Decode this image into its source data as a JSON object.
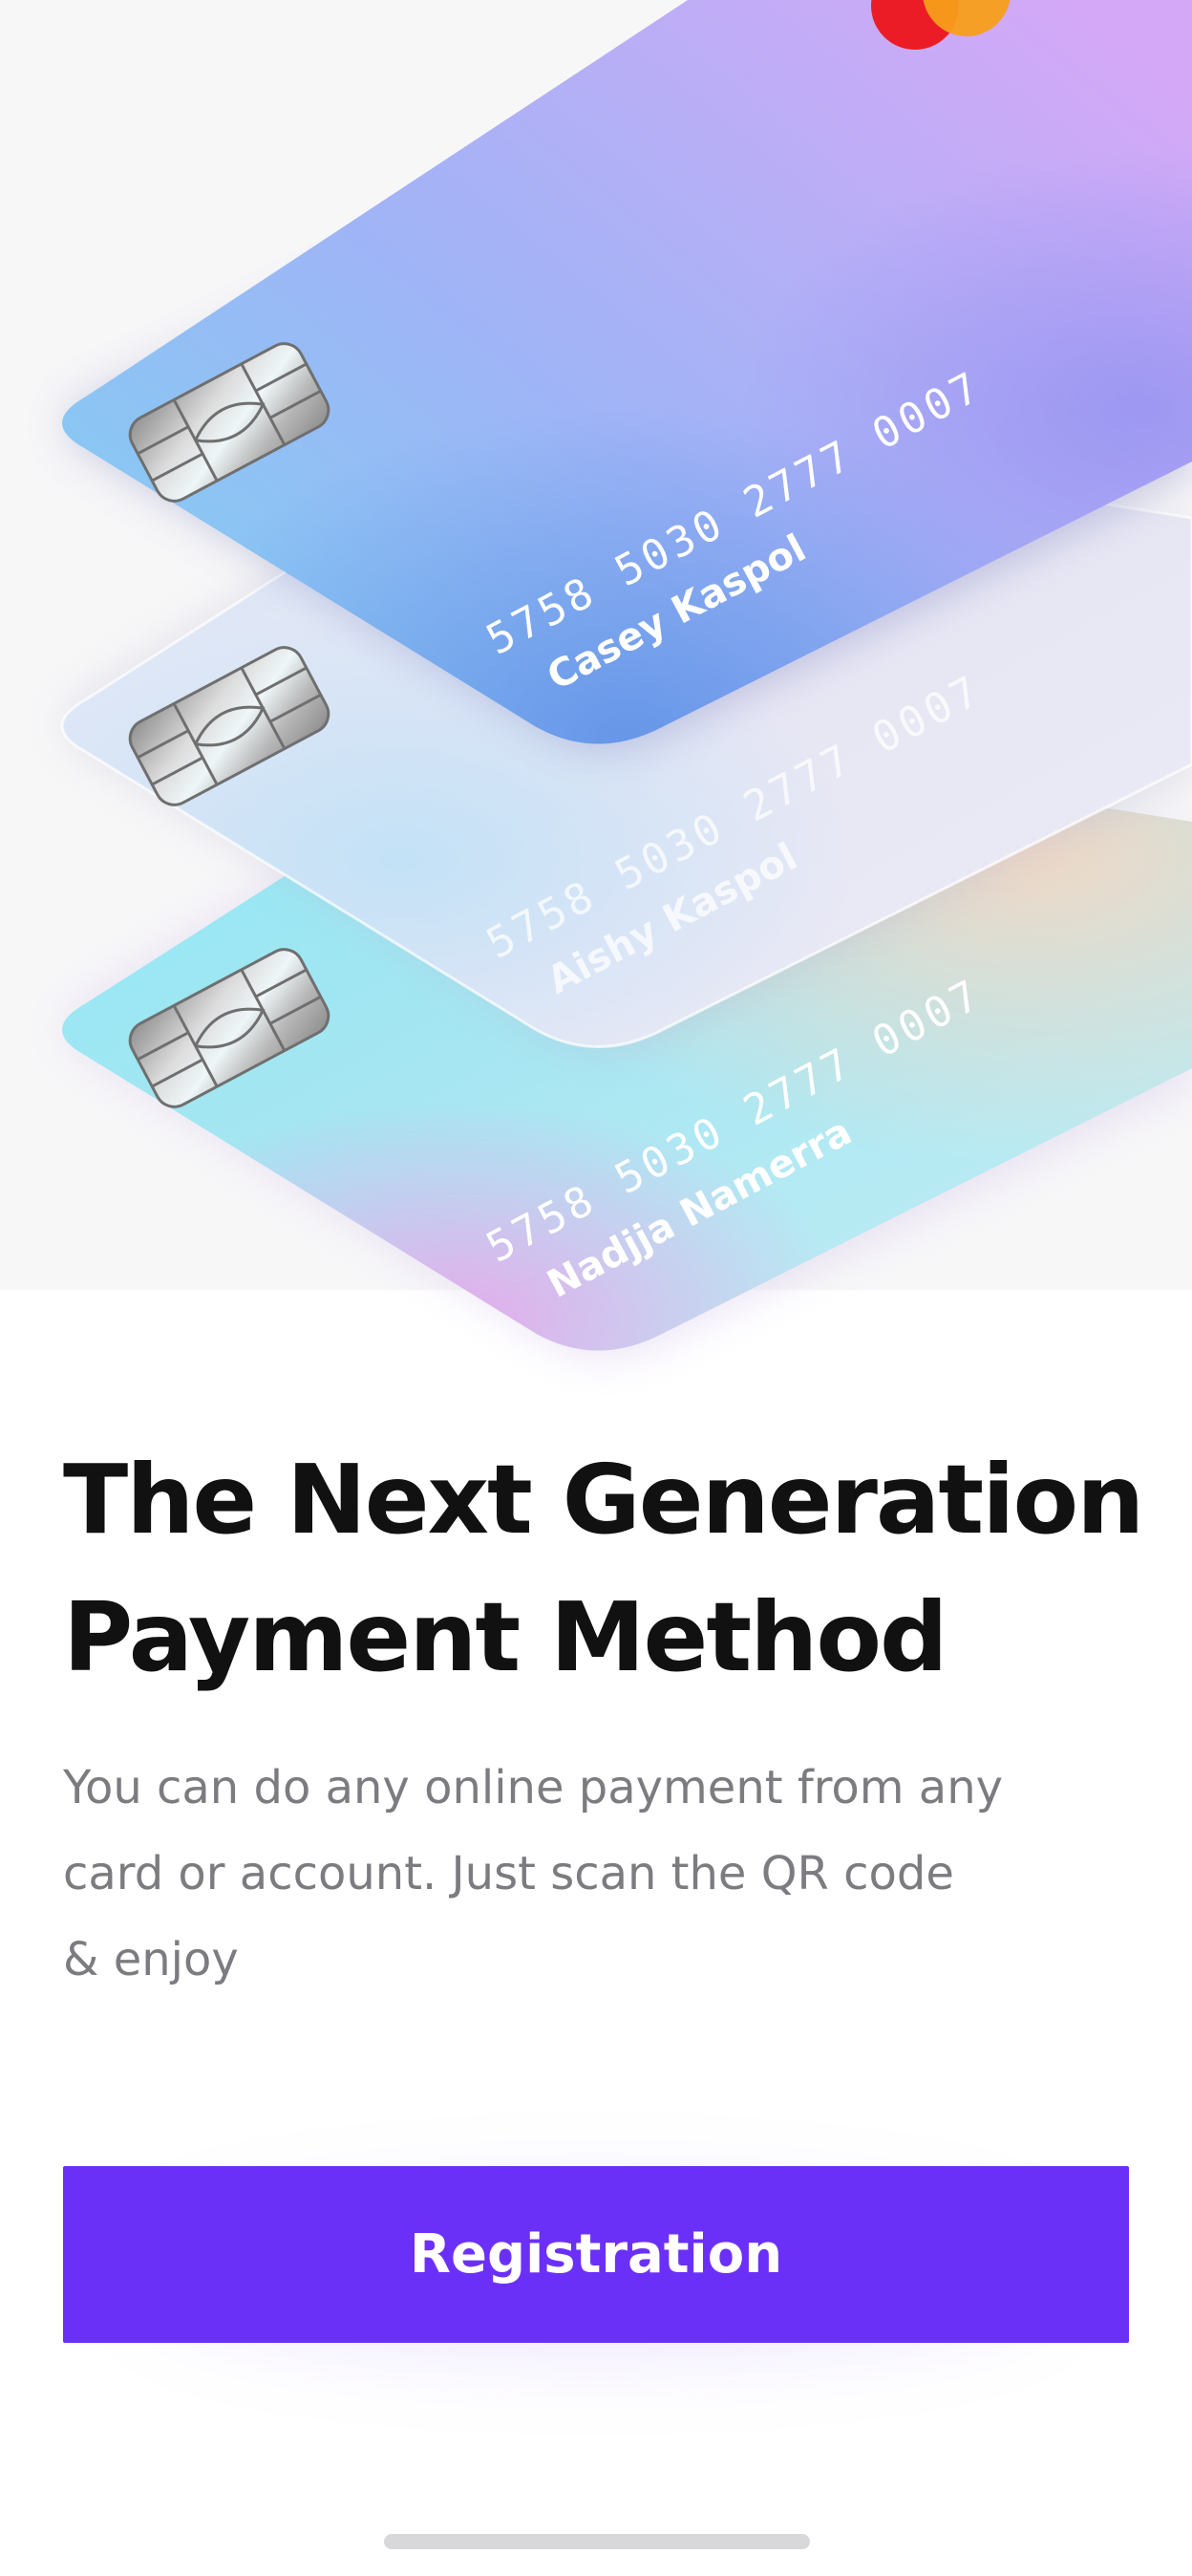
{
  "cards": [
    {
      "number": "5758 5030 2777 0007",
      "holder": "Nadjja Namerra",
      "style": "iridescent-aqua"
    },
    {
      "number": "5758 5030 2777 0007",
      "holder": "Aishy Kaspol",
      "style": "frosted-white"
    },
    {
      "number": "5758 5030 2777 0007",
      "holder": "Casey Kaspol",
      "style": "blue-violet"
    }
  ],
  "onboarding": {
    "title_line1": "The Next Generation",
    "title_line2": "Payment Method",
    "desc_line1": "You can do any online payment from any",
    "desc_line2": "card or account. Just scan the QR code",
    "desc_line3": "& enjoy",
    "cta_label": "Registration"
  },
  "colors": {
    "accent": "#6b30f8",
    "title": "#111111",
    "body": "#7c7c80",
    "hero_background": "#f7f7f8",
    "card_logo_red": "#eb1c26",
    "card_logo_orange": "#f79e1b"
  },
  "icons": [
    "chip-icon",
    "card-brand-logo-icon"
  ]
}
